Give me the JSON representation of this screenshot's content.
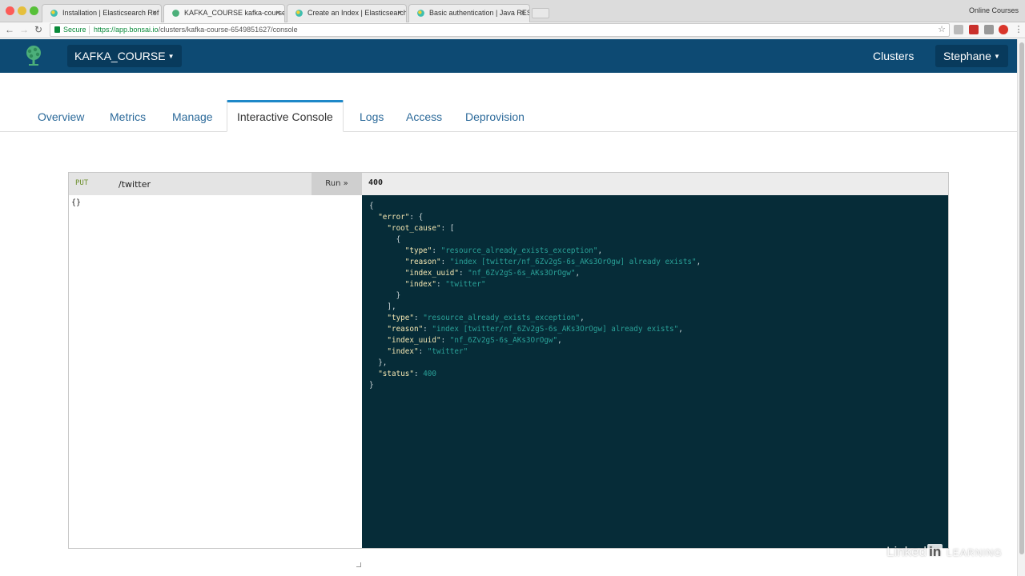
{
  "browser": {
    "tabs": [
      {
        "title": "Installation | Elasticsearch Ref",
        "active": false
      },
      {
        "title": "KAFKA_COURSE kafka-course",
        "active": true
      },
      {
        "title": "Create an Index | Elasticsearch",
        "active": false
      },
      {
        "title": "Basic authentication | Java RES",
        "active": false
      }
    ],
    "profile_name": "Online Courses",
    "secure_label": "Secure",
    "url_host": "https://app.bonsai.io",
    "url_path": "/clusters/kafka-course-6549851627/console",
    "tab_close_glyph": "×",
    "back_glyph": "←",
    "forward_glyph": "→",
    "reload_glyph": "↻",
    "star_glyph": "☆"
  },
  "header": {
    "cluster_name": "KAFKA_COURSE",
    "clusters_link": "Clusters",
    "user_name": "Stephane",
    "colors": {
      "background": "#0d4a73",
      "button": "#083a5c"
    }
  },
  "nav_tabs": [
    {
      "label": "Overview",
      "active": false
    },
    {
      "label": "Metrics",
      "active": false
    },
    {
      "label": "Manage",
      "active": false
    },
    {
      "label": "Interactive Console",
      "active": true
    },
    {
      "label": "Logs",
      "active": false
    },
    {
      "label": "Access",
      "active": false
    },
    {
      "label": "Deprovision",
      "active": false
    }
  ],
  "console": {
    "method": "PUT",
    "path": "/twitter",
    "run_label": "Run »",
    "request_body": "{}",
    "response_status": "400",
    "response_lines": [
      "{",
      "  \"error\": {",
      "    \"root_cause\": [",
      "      {",
      "        \"type\": \"resource_already_exists_exception\",",
      "        \"reason\": \"index [twitter/nf_6Zv2gS-6s_AKs3OrOgw] already exists\",",
      "        \"index_uuid\": \"nf_6Zv2gS-6s_AKs3OrOgw\",",
      "        \"index\": \"twitter\"",
      "      }",
      "    ],",
      "    \"type\": \"resource_already_exists_exception\",",
      "    \"reason\": \"index [twitter/nf_6Zv2gS-6s_AKs3OrOgw] already exists\",",
      "    \"index_uuid\": \"nf_6Zv2gS-6s_AKs3OrOgw\",",
      "    \"index\": \"twitter\"",
      "  },",
      "  \"status\": 400",
      "}"
    ]
  },
  "watermark": {
    "linked": "Linked",
    "in": "in",
    "learning": "LEARNING"
  }
}
